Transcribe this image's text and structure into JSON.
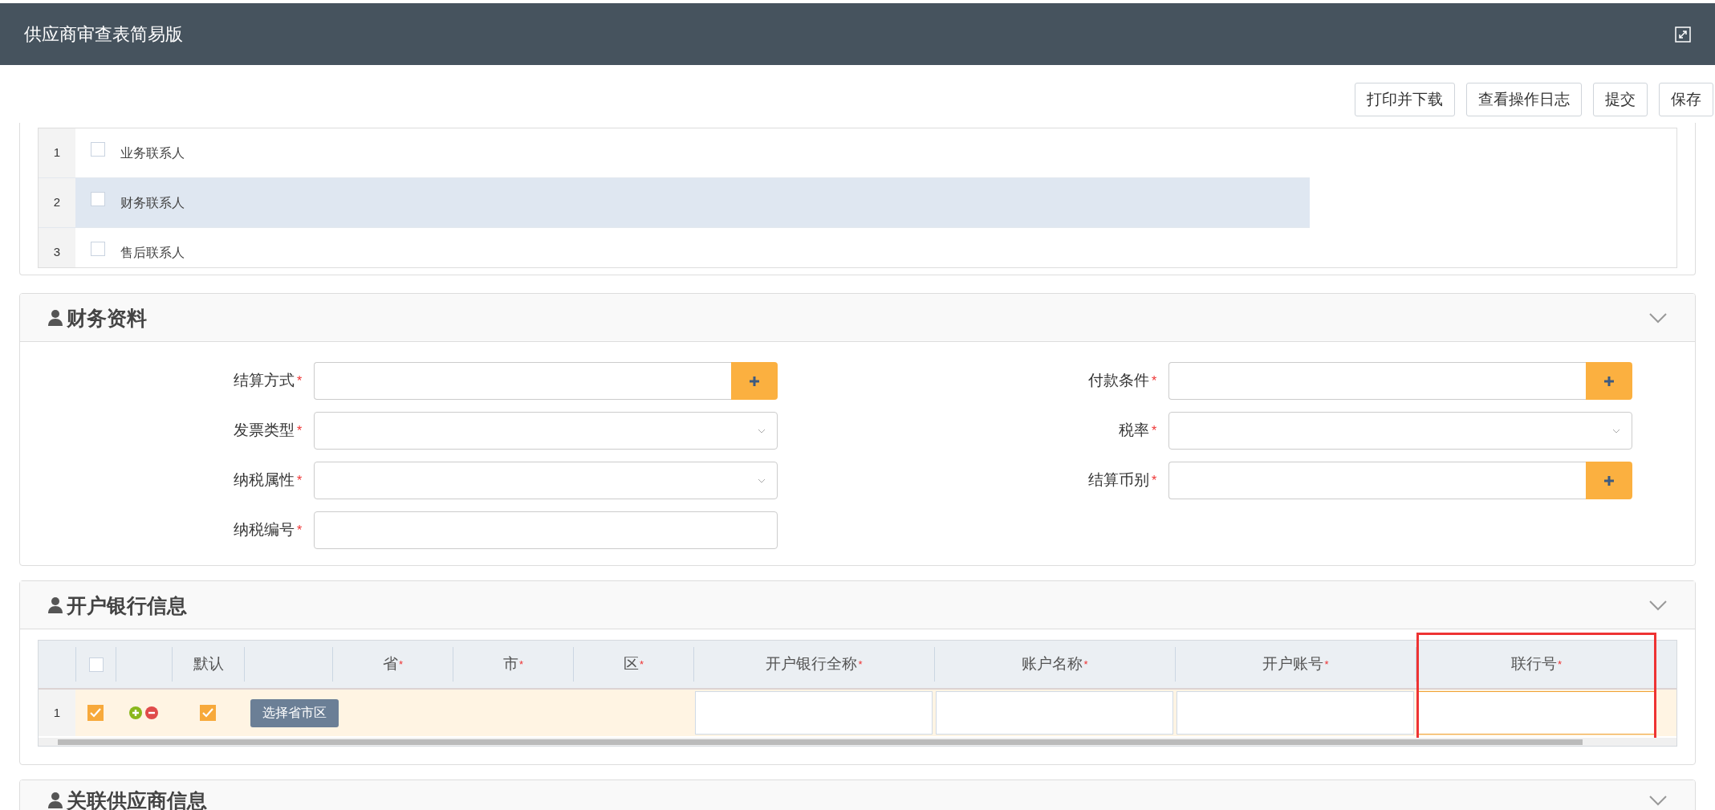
{
  "window": {
    "title": "供应商审查表简易版"
  },
  "toolbar": [
    "打印并下载",
    "查看操作日志",
    "提交",
    "保存"
  ],
  "contacts": [
    {
      "index": "1",
      "label": "业务联系人",
      "checked": false,
      "selected": false
    },
    {
      "index": "2",
      "label": "财务联系人",
      "checked": false,
      "selected": true
    },
    {
      "index": "3",
      "label": "售后联系人",
      "checked": false,
      "selected": false
    }
  ],
  "finance": {
    "title": "财务资料",
    "expanded": true,
    "fields": [
      {
        "label": "结算方式",
        "required_mark": "*",
        "kind": "lookup"
      },
      {
        "label": "付款条件",
        "required_mark": "*",
        "kind": "lookup"
      },
      {
        "label": "发票类型",
        "required_mark": "*",
        "kind": "select"
      },
      {
        "label": "税率",
        "required_mark": "*",
        "kind": "select"
      },
      {
        "label": "纳税属性",
        "required_mark": "*",
        "kind": "select"
      },
      {
        "label": "结算币别",
        "required_mark": "*",
        "kind": "lookup"
      },
      {
        "label": "纳税编号",
        "required_mark": "*",
        "kind": "text"
      }
    ]
  },
  "bank": {
    "title": "开户银行信息",
    "expanded": true,
    "columns": [
      {
        "label": "默认",
        "highlighted": false
      },
      {
        "label": "省",
        "required_mark": "*",
        "highlighted": false
      },
      {
        "label": "市",
        "required_mark": "*",
        "highlighted": false
      },
      {
        "label": "区",
        "required_mark": "*",
        "highlighted": false
      },
      {
        "label": "开户银行全称",
        "required_mark": "*",
        "highlighted": false
      },
      {
        "label": "账户名称",
        "required_mark": "*",
        "highlighted": false
      },
      {
        "label": "开户账号",
        "required_mark": "*",
        "highlighted": false
      },
      {
        "label": "联行号",
        "required_mark": "*",
        "highlighted": true
      }
    ],
    "select_all": false,
    "rows": [
      {
        "index": "1",
        "checked": true,
        "default": true,
        "button": "选择省市区"
      }
    ]
  },
  "related": {
    "title": "关联供应商信息",
    "expanded": true
  }
}
